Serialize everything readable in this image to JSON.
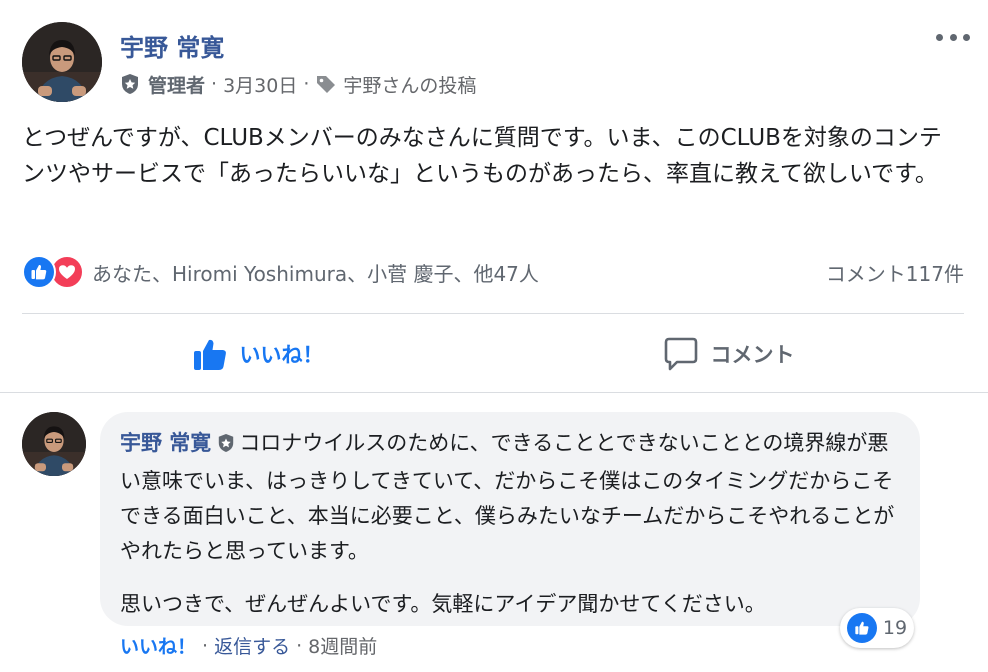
{
  "post": {
    "author": "宇野 常寛",
    "role": "管理者",
    "date": "3月30日",
    "tag_label": "宇野さんの投稿",
    "body": "とつぜんですが、CLUBメンバーのみなさんに質問です。いま、このCLUBを対象のコンテンツやサービスで「あったらいいな」というものがあったら、率直に教えて欲しいです。",
    "reactions_summary": "あなた、Hiromi Yoshimura、小菅 慶子、他47人",
    "comment_count": "コメント117件"
  },
  "actions": {
    "like_label": "いいね！",
    "comment_label": "コメント"
  },
  "comment": {
    "author": "宇野 常寛",
    "text1": "コロナウイルスのために、できることとできないこととの境界線が悪い意味でいま、はっきりしてきていて、だからこそ僕はこのタイミングだからこそできる面白いこと、本当に必要こと、僕らみたいなチームだからこそやれることがやれたらと思っています。",
    "text2": "思いつきで、ぜんぜんよいです。気軽にアイデア聞かせてください。",
    "reaction_count": "19",
    "like_label": "いいね！",
    "reply_label": "返信する",
    "time": "8週間前"
  },
  "colors": {
    "accent": "#1877f2",
    "name_link": "#385898",
    "love": "#f33e58",
    "muted": "#606770",
    "bubble": "#f2f3f5"
  },
  "icons": {
    "badge": "admin-shield-icon",
    "tag": "tag-icon",
    "like": "thumbs-up-icon",
    "love": "heart-icon",
    "comment": "speech-bubble-icon",
    "more": "more-dots-icon"
  }
}
